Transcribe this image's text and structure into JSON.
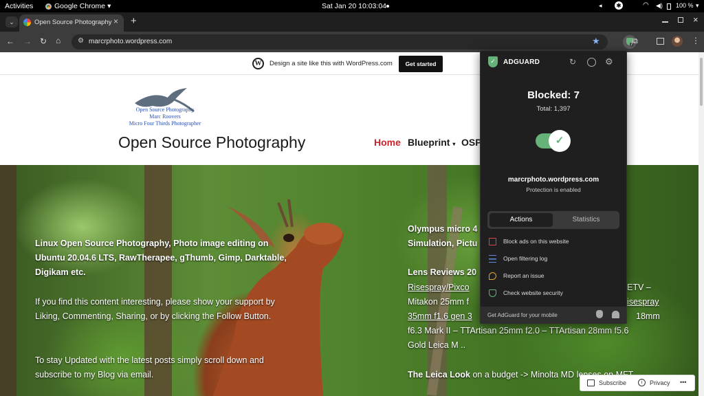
{
  "system_bar": {
    "activities": "Activities",
    "app": "Google Chrome",
    "app_arrow": "▾",
    "clock": "Sat Jan 20  10:03:04",
    "battery": "100 %"
  },
  "browser": {
    "tab_title": "Open Source Photography",
    "new_tab": "+",
    "url": "marcrphoto.wordpress.com",
    "extension_badge": "7"
  },
  "wp_banner": {
    "text": "Design a site like this with WordPress.com",
    "cta": "Get started"
  },
  "site": {
    "logo_lines": [
      "Open Source Photography",
      "Marc Roovers",
      "Micro Four Thirds Photographer"
    ],
    "title": "Open Source Photography",
    "nav": [
      "Home",
      "Blueprint",
      "OSP"
    ],
    "nav_blueprint_arrow": "▾"
  },
  "hero_left": {
    "heading": "Linux Open Source Photography, Photo image editing on Ubuntu 20.04.6 LTS, RawTherapee, gThumb, Gimp, Darktable, Digikam etc.",
    "para1": "If you find this content interesting, please show your support by Liking, Commenting, Sharing, or by clicking the Follow Button.",
    "para2": "To stay Updated with the latest posts simply scroll down and subscribe to my Blog via email."
  },
  "hero_right": {
    "line1": "Olympus micro 4",
    "line2": "Simulation, Pictu",
    "lens_heading": "Lens Reviews 20",
    "lens_line1": "Risespray/Pixco",
    "lens_line1_tail": "ETV –",
    "lens_line2": "Mitakon 25mm f",
    "lens_line2_tail": "isespray",
    "lens_line3": "35mm f1.6 gen 3",
    "lens_line3_tail": "18mm",
    "lens_line4": "f6.3 Mark II – TTArtisan 25mm f2.0 – TTArtisan 28mm f5.6",
    "lens_line5": "Gold Leica M ..",
    "leica_bold": "The Leica Look",
    "leica_rest": " on a budget -> Minolta MD lenses on MFT"
  },
  "footer_bar": {
    "subscribe": "Subscribe",
    "privacy": "Privacy",
    "more": "•••"
  },
  "adguard": {
    "brand": "ADGUARD",
    "blocked": "Blocked: 7",
    "total": "Total: 1,397",
    "domain": "marcrphoto.wordpress.com",
    "status": "Protection is enabled",
    "tabs": [
      "Actions",
      "Statistics"
    ],
    "actions": [
      "Block ads on this website",
      "Open filtering log",
      "Report an issue",
      "Check website security"
    ],
    "footer": "Get AdGuard for your mobile"
  },
  "colors": {
    "accent_green": "#67b279",
    "nav_active": "#c9252f",
    "popup_bg": "#1f1f1f"
  }
}
